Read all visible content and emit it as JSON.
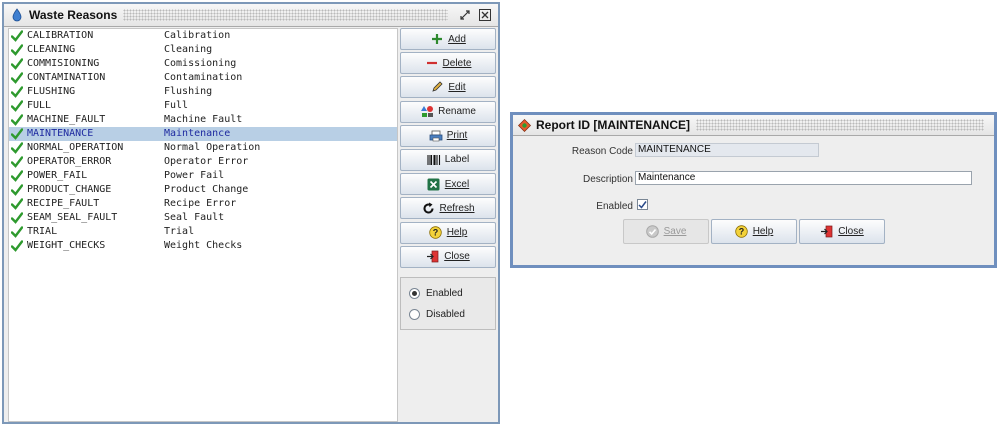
{
  "main_window": {
    "title": "Waste Reasons",
    "rows": [
      {
        "code": "CALIBRATION",
        "desc": "Calibration"
      },
      {
        "code": "CLEANING",
        "desc": "Cleaning"
      },
      {
        "code": "COMMISIONING",
        "desc": "Comissioning"
      },
      {
        "code": "CONTAMINATION",
        "desc": "Contamination"
      },
      {
        "code": "FLUSHING",
        "desc": "Flushing"
      },
      {
        "code": "FULL",
        "desc": "Full"
      },
      {
        "code": "MACHINE_FAULT",
        "desc": "Machine Fault"
      },
      {
        "code": "MAINTENANCE",
        "desc": "Maintenance"
      },
      {
        "code": "NORMAL_OPERATION",
        "desc": "Normal Operation"
      },
      {
        "code": "OPERATOR_ERROR",
        "desc": "Operator Error"
      },
      {
        "code": "POWER_FAIL",
        "desc": "Power Fail"
      },
      {
        "code": "PRODUCT_CHANGE",
        "desc": "Product Change"
      },
      {
        "code": "RECIPE_FAULT",
        "desc": "Recipe Error"
      },
      {
        "code": "SEAM_SEAL_FAULT",
        "desc": "Seal Fault"
      },
      {
        "code": "TRIAL",
        "desc": "Trial"
      },
      {
        "code": "WEIGHT_CHECKS",
        "desc": "Weight Checks"
      }
    ],
    "selected_index": 7,
    "buttons": {
      "add": "Add",
      "delete": "Delete",
      "edit": "Edit",
      "rename": "Rename",
      "print": "Print",
      "label": "Label",
      "excel": "Excel",
      "refresh": "Refresh",
      "help": "Help",
      "close": "Close"
    },
    "filter": {
      "enabled": "Enabled",
      "disabled": "Disabled",
      "selected": "enabled"
    }
  },
  "dialog": {
    "title": "Report ID [MAINTENANCE]",
    "reason_code_label": "Reason Code",
    "reason_code_value": "MAINTENANCE",
    "description_label": "Description",
    "description_value": "Maintenance",
    "enabled_label": "Enabled",
    "enabled_checked": true,
    "buttons": {
      "save": "Save",
      "help": "Help",
      "close": "Close"
    }
  },
  "colors": {
    "selection": "#b8cfe5",
    "check_green": "#2e9a2e",
    "window_border": "#7d98b8"
  }
}
